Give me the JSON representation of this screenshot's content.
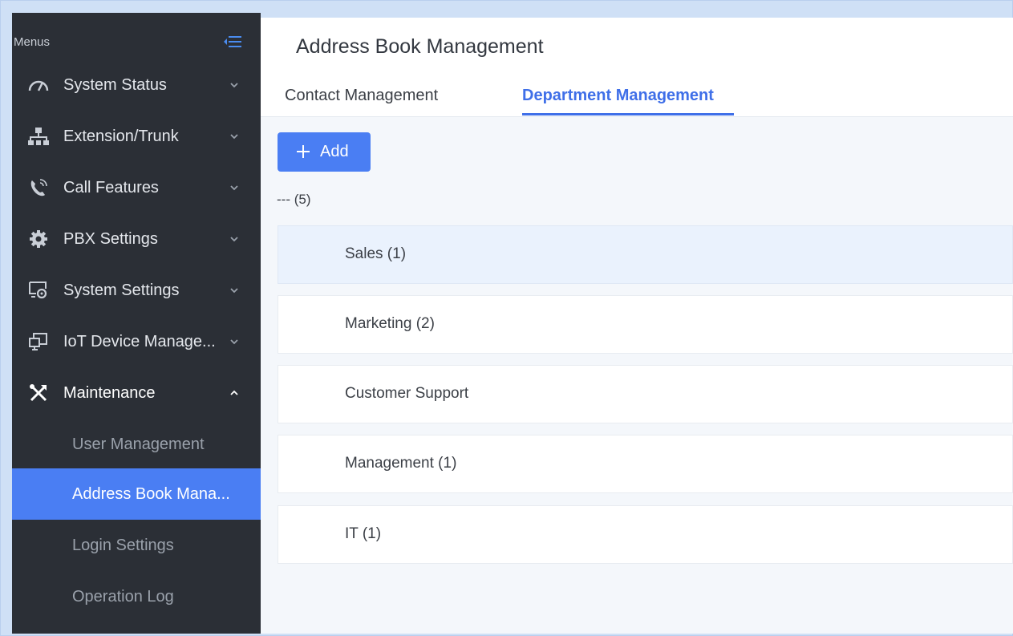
{
  "sidebar": {
    "menus_label": "Menus",
    "items": [
      {
        "label": "System Status",
        "icon": "gauge-icon",
        "expanded": false
      },
      {
        "label": "Extension/Trunk",
        "icon": "network-icon",
        "expanded": false
      },
      {
        "label": "Call Features",
        "icon": "phone-icon",
        "expanded": false
      },
      {
        "label": "PBX Settings",
        "icon": "gear-icon",
        "expanded": false
      },
      {
        "label": "System Settings",
        "icon": "screen-gear-icon",
        "expanded": false
      },
      {
        "label": "IoT Device Manage...",
        "icon": "devices-icon",
        "expanded": false
      },
      {
        "label": "Maintenance",
        "icon": "tools-icon",
        "expanded": true
      }
    ],
    "sub_items": [
      {
        "label": "User Management",
        "active": false
      },
      {
        "label": "Address Book Mana...",
        "active": true
      },
      {
        "label": "Login Settings",
        "active": false
      },
      {
        "label": "Operation Log",
        "active": false
      }
    ]
  },
  "main": {
    "title": "Address Book Management",
    "tabs": [
      {
        "label": "Contact Management",
        "active": false
      },
      {
        "label": "Department Management",
        "active": true
      }
    ],
    "add_button_label": "Add",
    "root_label": "--- (5)",
    "departments": [
      {
        "label": "Sales (1)",
        "selected": true
      },
      {
        "label": "Marketing (2)",
        "selected": false
      },
      {
        "label": "Customer Support",
        "selected": false
      },
      {
        "label": "Management (1)",
        "selected": false
      },
      {
        "label": "IT (1)",
        "selected": false
      }
    ]
  },
  "colors": {
    "sidebar_bg": "#2b2f36",
    "accent": "#4a7ef3",
    "tab_active": "#3f6fe8",
    "selected_row": "#eaf2fd"
  }
}
